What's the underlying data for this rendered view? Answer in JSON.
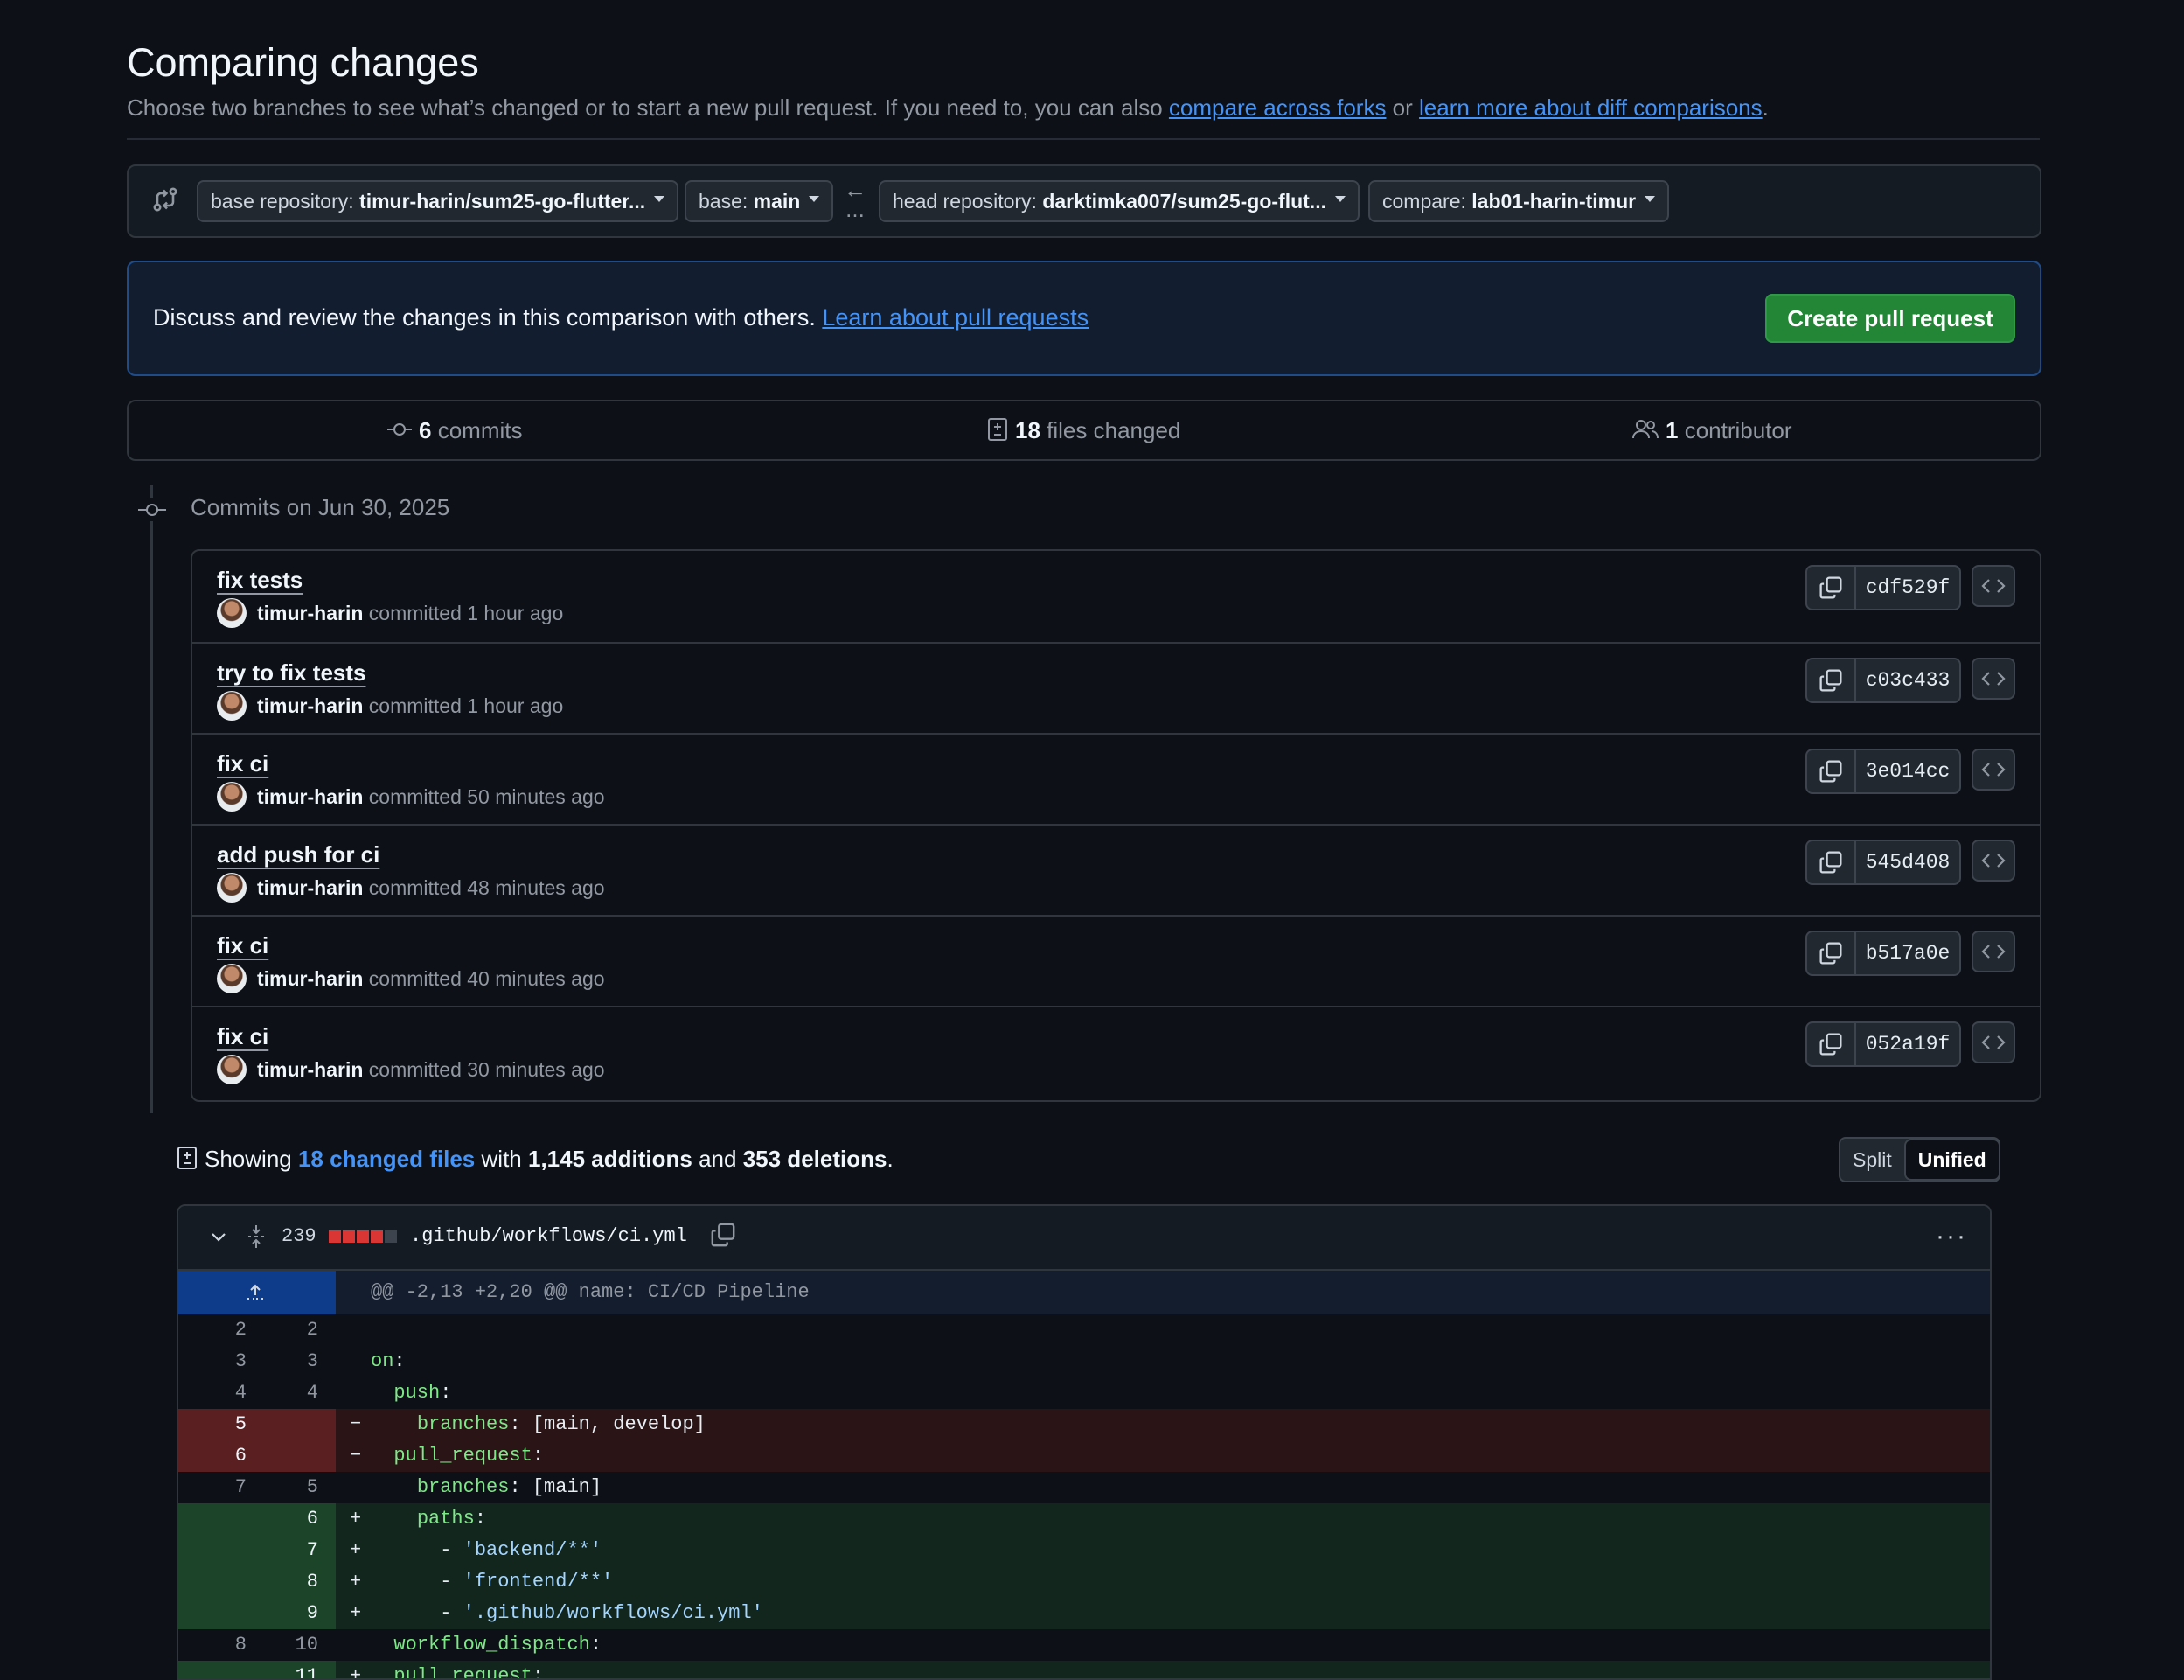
{
  "page": {
    "title": "Comparing changes",
    "subtitle_prefix": "Choose two branches to see what’s changed or to start a new pull request. If you need to, you can also ",
    "link_forks": "compare across forks",
    "subtitle_or": " or ",
    "link_learn_diff": "learn more about diff comparisons",
    "subtitle_suffix": "."
  },
  "range": {
    "base_repo_label": "base repository:",
    "base_repo_value": "timur-harin/sum25-go-flutter...",
    "base_label": "base:",
    "base_value": "main",
    "arrow": "←",
    "dots": "...",
    "head_repo_label": "head repository:",
    "head_repo_value": "darktimka007/sum25-go-flut...",
    "compare_label": "compare:",
    "compare_value": "lab01-harin-timur"
  },
  "banner": {
    "text": "Discuss and review the changes in this comparison with others.",
    "link": "Learn about pull requests",
    "create_button": "Create pull request"
  },
  "stats": {
    "commits_count": "6",
    "commits_label": "commits",
    "files_count": "18",
    "files_label": "files changed",
    "contrib_count": "1",
    "contrib_label": "contributor"
  },
  "commits_header": "Commits on Jun 30, 2025",
  "commits": [
    {
      "title": "fix tests",
      "author": "timur-harin",
      "time": "committed 1 hour ago",
      "sha": "cdf529f"
    },
    {
      "title": "try to fix tests",
      "author": "timur-harin",
      "time": "committed 1 hour ago",
      "sha": "c03c433"
    },
    {
      "title": "fix ci",
      "author": "timur-harin",
      "time": "committed 50 minutes ago",
      "sha": "3e014cc"
    },
    {
      "title": "add push for ci",
      "author": "timur-harin",
      "time": "committed 48 minutes ago",
      "sha": "545d408"
    },
    {
      "title": "fix ci",
      "author": "timur-harin",
      "time": "committed 40 minutes ago",
      "sha": "b517a0e"
    },
    {
      "title": "fix ci",
      "author": "timur-harin",
      "time": "committed 30 minutes ago",
      "sha": "052a19f"
    }
  ],
  "summary": {
    "showing": "Showing",
    "changed_files": "18 changed files",
    "with": "with",
    "additions": "1,145 additions",
    "and": "and",
    "deletions": "353 deletions",
    "period": "."
  },
  "view_toggle": {
    "split": "Split",
    "unified": "Unified"
  },
  "diff": {
    "count": "239",
    "filename": ".github/workflows/ci.yml",
    "diffstat_colors": [
      "#da3633",
      "#da3633",
      "#da3633",
      "#da3633",
      "#3d444d"
    ],
    "hunk": "@@ -2,13 +2,20 @@ name: CI/CD Pipeline",
    "lines": [
      {
        "type": "ctx",
        "old": "2",
        "new": "2",
        "sign": "",
        "code": ""
      },
      {
        "type": "ctx",
        "old": "3",
        "new": "3",
        "sign": "",
        "key": "on",
        "rest": ":"
      },
      {
        "type": "ctx",
        "old": "4",
        "new": "4",
        "sign": "",
        "indent": "  ",
        "key": "push",
        "rest": ":"
      },
      {
        "type": "del",
        "old": "5",
        "new": "",
        "sign": "−",
        "indent": "    ",
        "key": "branches",
        "rest": ": [main, develop]"
      },
      {
        "type": "del",
        "old": "6",
        "new": "",
        "sign": "−",
        "indent": "  ",
        "key": "pull_request",
        "rest": ":"
      },
      {
        "type": "ctx",
        "old": "7",
        "new": "5",
        "sign": "",
        "indent": "    ",
        "key": "branches",
        "rest": ": [main]"
      },
      {
        "type": "add",
        "old": "",
        "new": "6",
        "sign": "+",
        "indent": "    ",
        "key": "paths",
        "rest": ":"
      },
      {
        "type": "add",
        "old": "",
        "new": "7",
        "sign": "+",
        "indent": "      - ",
        "str": "'backend/**'"
      },
      {
        "type": "add",
        "old": "",
        "new": "8",
        "sign": "+",
        "indent": "      - ",
        "str": "'frontend/**'"
      },
      {
        "type": "add",
        "old": "",
        "new": "9",
        "sign": "+",
        "indent": "      - ",
        "str": "'.github/workflows/ci.yml'"
      },
      {
        "type": "ctx",
        "old": "8",
        "new": "10",
        "sign": "",
        "indent": "  ",
        "key": "workflow_dispatch",
        "rest": ":"
      },
      {
        "type": "add",
        "old": "",
        "new": "11",
        "sign": "+",
        "indent": "  ",
        "key": "pull_request",
        "rest": ":"
      }
    ]
  }
}
